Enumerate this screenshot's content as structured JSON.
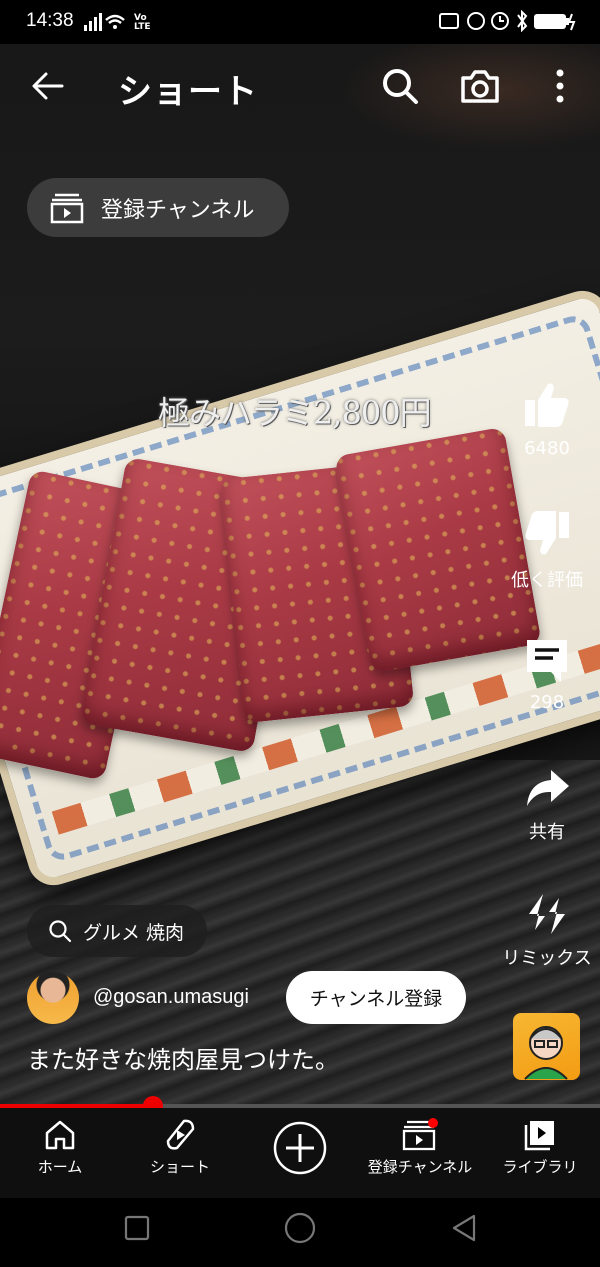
{
  "status_bar": {
    "time": "14:38",
    "network_label": "Vo LTE"
  },
  "header": {
    "title": "ショート"
  },
  "subscriptions_pill": {
    "label": "登録チャンネル"
  },
  "video": {
    "overlay_text": "極みハラミ2,800円"
  },
  "actions": {
    "like_count": "6480",
    "dislike_label": "低く評価",
    "comment_count": "298",
    "share_label": "共有",
    "remix_label": "リミックス"
  },
  "search_chip": {
    "label": "グルメ 焼肉"
  },
  "channel": {
    "handle": "@gosan.umasugi",
    "subscribe_label": "チャンネル登録"
  },
  "caption": "また好きな焼肉屋見つけた。",
  "progress": {
    "fraction": 0.255
  },
  "bottom_nav": {
    "items": [
      {
        "label": "ホーム",
        "icon": "home-icon"
      },
      {
        "label": "ショート",
        "icon": "shorts-icon"
      },
      {
        "label": "",
        "icon": "create-icon"
      },
      {
        "label": "登録チャンネル",
        "icon": "subscriptions-icon"
      },
      {
        "label": "ライブラリ",
        "icon": "library-icon"
      }
    ]
  },
  "colors": {
    "accent": "#ff0000",
    "background": "#000000",
    "nav": "#0f0f0f"
  }
}
